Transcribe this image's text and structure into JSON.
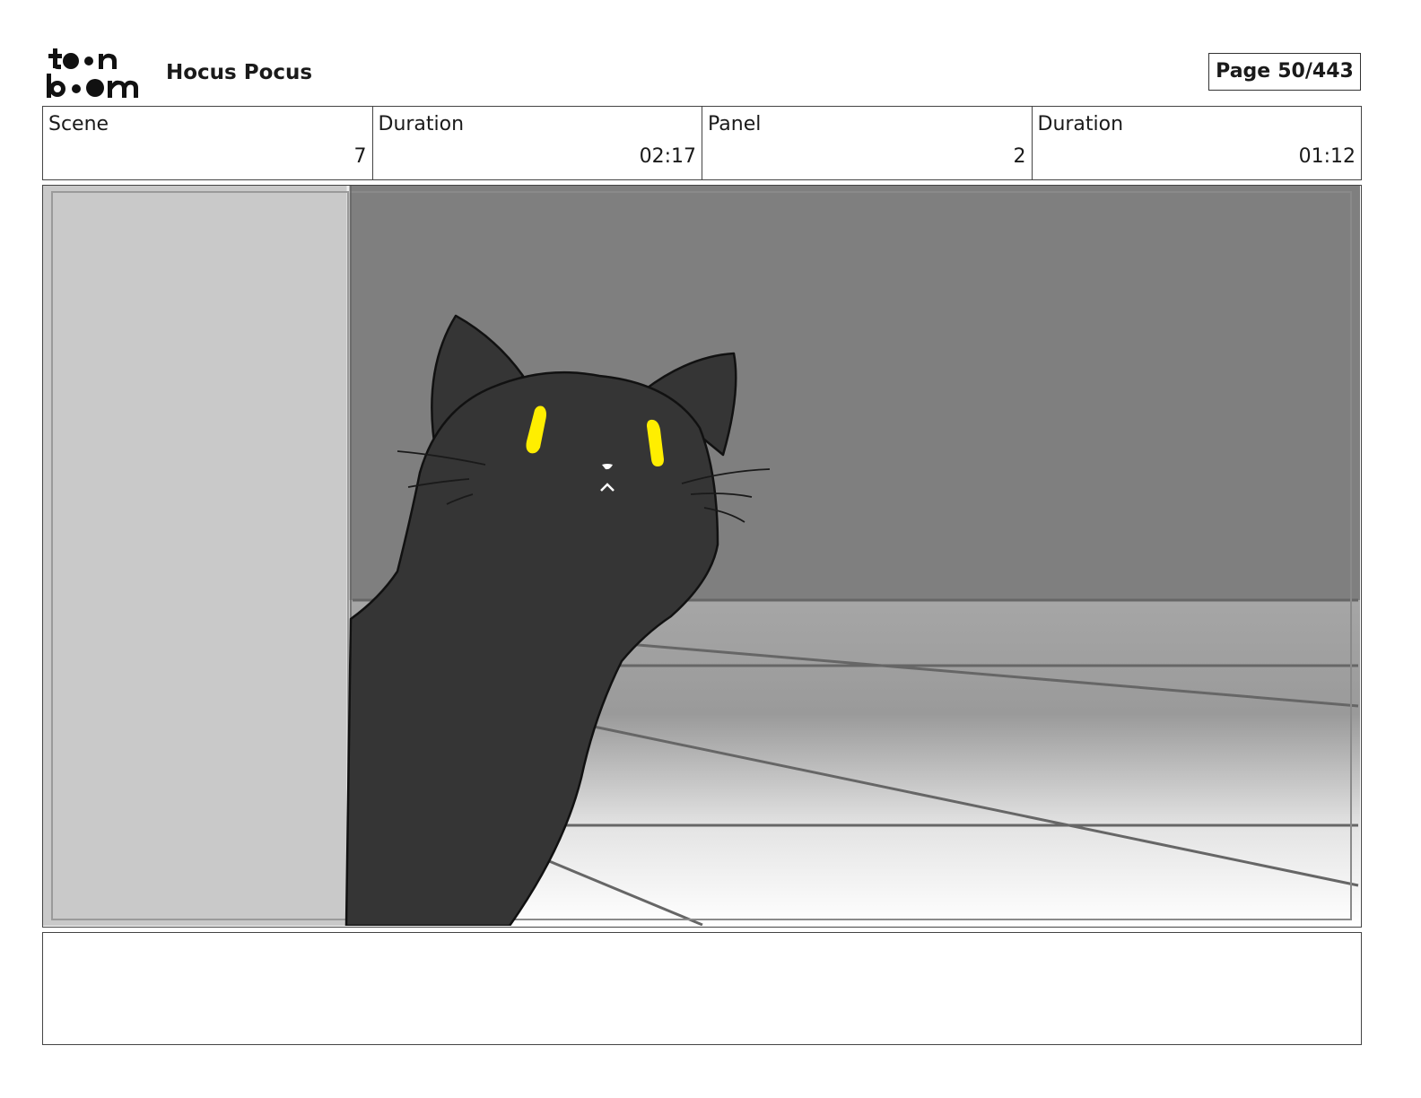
{
  "header": {
    "logo_text": "toon boom",
    "project_title": "Hocus Pocus",
    "page_label": "Page",
    "page_number": "50/443"
  },
  "info": {
    "scene_label": "Scene",
    "scene_value": "7",
    "scene_duration_label": "Duration",
    "scene_duration_value": "02:17",
    "panel_label": "Panel",
    "panel_value": "2",
    "panel_duration_label": "Duration",
    "panel_duration_value": "01:12"
  },
  "panel_image": {
    "subject": "black cat with yellow eyes peeking around a wall",
    "colors": {
      "wall": "#c9c9c9",
      "background": "#7f7f7f",
      "cat": "#353535",
      "eyes": "#ffee00",
      "floor_lines": "#666666"
    }
  },
  "notes": {
    "text": ""
  }
}
